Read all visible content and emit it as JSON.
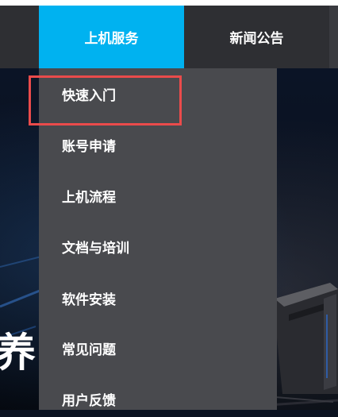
{
  "nav": {
    "active_tab": "上机服务",
    "news_tab": "新闻公告"
  },
  "dropdown": {
    "items": [
      "快速入门",
      "账号申请",
      "上机流程",
      "文档与培训",
      "软件安装",
      "常见问题",
      "用户反馈"
    ]
  },
  "hero": {
    "partial_text": "养"
  },
  "colors": {
    "nav_bg": "#2e2f33",
    "active_tab_bg": "#00b2f0",
    "dropdown_bg": "#494a4e",
    "highlight_border": "#ea4b4b"
  }
}
